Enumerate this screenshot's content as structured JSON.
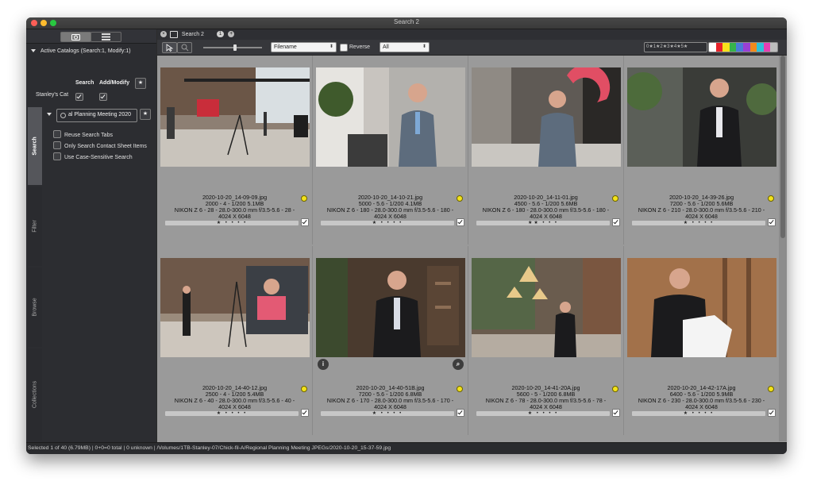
{
  "window": {
    "title": "Search 2"
  },
  "sidebar": {
    "catalogs_label": "Active Catalogs (Search:1, Modify:1)",
    "col_search": "Search",
    "col_add": "Add/Modify",
    "catalog_name": "Stanley's Cat",
    "search_text": "al Planning Meeting 2020",
    "options": [
      "Reuse Search Tabs",
      "Only Search Contact Sheet Items",
      "Use Case-Sensitive Search"
    ],
    "tabs": [
      "Search",
      "Filter",
      "Browse",
      "Collections"
    ]
  },
  "tabbar": {
    "tab_label": "Search 2",
    "tab_count": "1"
  },
  "toolbar": {
    "sort_field": "Filename",
    "reverse_label": "Reverse",
    "filter_value": "All",
    "rating_filter": "0★1★2★3★4★5★",
    "label_colors": [
      "#ffffff",
      "#e7222a",
      "#f7e11c",
      "#36b34a",
      "#4a7bd8",
      "#9a3fd5",
      "#f18a1c",
      "#2ec2d8",
      "#e53fb2",
      "#bdbdbd"
    ]
  },
  "thumbnails": [
    {
      "filename": "2020-10-20_14-09-09.jpg",
      "line2": "2000 - 4 - 1/200 5.1MB",
      "line3": "NIKON Z 6 - 28 - 28.0-300.0 mm f/3.5-5.6 - 28 -",
      "line4": "4024 X 6048",
      "stars": "★ • • • •"
    },
    {
      "filename": "2020-10-20_14-10-21.jpg",
      "line2": "5000 - 5.6 - 1/200 4.1MB",
      "line3": "NIKON Z 6 - 180 - 28.0-300.0 mm f/3.5-5.6 - 180 -",
      "line4": "4024 X 6048",
      "stars": "★ • • • •"
    },
    {
      "filename": "2020-10-20_14-11-01.jpg",
      "line2": "4500 - 5.6 - 1/200 5.6MB",
      "line3": "NIKON Z 6 - 180 - 28.0-300.0 mm f/3.5-5.6 - 180 -",
      "line4": "4024 X 6048",
      "stars": "★★ • • •"
    },
    {
      "filename": "2020-10-20_14-39-26.jpg",
      "line2": "7200 - 5.6 - 1/200 5.6MB",
      "line3": "NIKON Z 6 - 210 - 28.0-300.0 mm f/3.5-5.6 - 210 -",
      "line4": "4024 X 6048",
      "stars": "★ • • • •"
    },
    {
      "filename": "2020-10-20_14-40-12.jpg",
      "line2": "2500 - 4 - 1/200 5.4MB",
      "line3": "NIKON Z 6 - 40 - 28.0-300.0 mm f/3.5-5.6 - 40 -",
      "line4": "4024 X 6048",
      "stars": "★ • • • •"
    },
    {
      "filename": "2020-10-20_14-40-51B.jpg",
      "line2": "7200 - 5.6 - 1/200 6.8MB",
      "line3": "NIKON Z 6 - 170 - 28.0-300.0 mm f/3.5-5.6 - 170 -",
      "line4": "4024 X 6048",
      "stars": "★ • • • •"
    },
    {
      "filename": "2020-10-20_14-41-20A.jpg",
      "line2": "5600 - 5 - 1/200 6.8MB",
      "line3": "NIKON Z 6 - 78 - 28.0-300.0 mm f/3.5-5.6 - 78 -",
      "line4": "4024 X 6048",
      "stars": "★ • • • •"
    },
    {
      "filename": "2020-10-20_14-42-17A.jpg",
      "line2": "6400 - 5.6 - 1/200 5.9MB",
      "line3": "NIKON Z 6 - 230 - 28.0-300.0 mm f/3.5-5.6 - 230 -",
      "line4": "4024 X 6048",
      "stars": "★ • • • •"
    }
  ],
  "status": "Selected 1 of 40 (6.79MB) | 0+0=0 total | 0 unknown | /Volumes/1TB-Stanley-07/Chick-fil-A/Regional Planning Meeting JPEGs/2020-10-20_15-37-59.jpg"
}
